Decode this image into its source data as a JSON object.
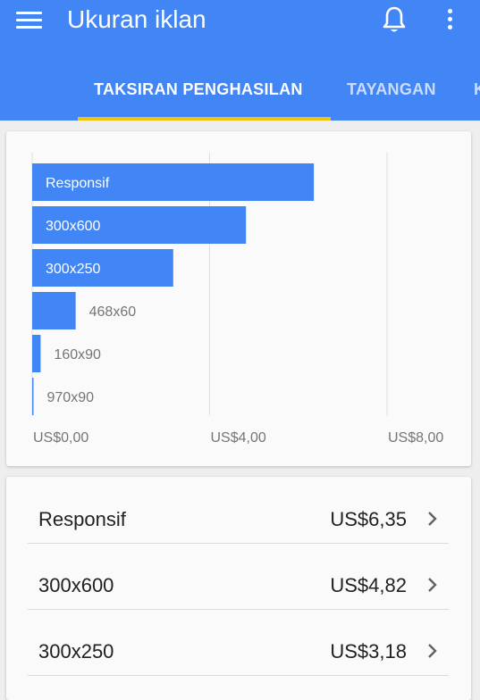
{
  "app_bar": {
    "title": "Ukuran iklan",
    "icons": [
      "menu-icon",
      "bell-icon",
      "more-vert-icon"
    ]
  },
  "tabs": [
    {
      "label": "TAKSIRAN PENGHASILAN",
      "selected": true
    },
    {
      "label": "TAYANGAN",
      "selected": false
    },
    {
      "label": "K",
      "selected": false
    }
  ],
  "colors": {
    "primary": "#4285f4",
    "indicator": "#f4c20d",
    "bar": "#4285f4"
  },
  "chart_data": {
    "type": "bar",
    "orientation": "horizontal",
    "categories": [
      "Responsif",
      "300x600",
      "300x250",
      "468x60",
      "160x90",
      "970x90"
    ],
    "values": [
      6.35,
      4.82,
      3.18,
      0.98,
      0.19,
      0.03
    ],
    "x_ticks": [
      "US$0,00",
      "US$4,00",
      "US$8,00"
    ],
    "xlim": [
      0,
      8
    ],
    "grid": true
  },
  "list": {
    "rows": [
      {
        "name": "Responsif",
        "value": "US$6,35"
      },
      {
        "name": "300x600",
        "value": "US$4,82"
      },
      {
        "name": "300x250",
        "value": "US$3,18"
      }
    ]
  }
}
